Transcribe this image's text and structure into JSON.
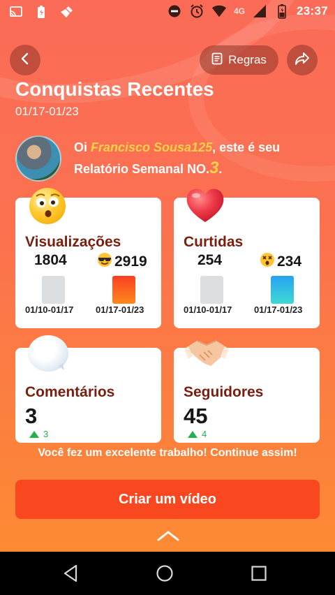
{
  "status_bar": {
    "time": "23:37",
    "network": "4G",
    "left_icons": [
      "cast-icon",
      "battery-saver-icon",
      "broom-icon"
    ],
    "right_icons": [
      "do-not-disturb-icon",
      "alarm-icon",
      "wifi-icon",
      "signal-icon",
      "battery-icon"
    ]
  },
  "header": {
    "back_icon": "chevron-left-icon",
    "rules_label": "Regras",
    "rules_icon": "document-icon",
    "share_icon": "share-icon"
  },
  "page": {
    "title": "Conquistas Recentes",
    "date_range": "01/17-01/23"
  },
  "greeting": {
    "prefix": "Oi ",
    "username": "Francisco Sousa125",
    "middle": ", este é seu Relatório Semanal NO.",
    "report_number": "3",
    "suffix": "."
  },
  "cards": {
    "views": {
      "title": "Visualizações",
      "icon": "dizzy-face-emoji",
      "prev_value": "1804",
      "curr_value": "2919",
      "curr_emoji": "cool-face-emoji",
      "prev_label": "01/10-01/17",
      "curr_label": "01/17-01/23",
      "prev_color": "#dcdfe1",
      "curr_color": "#fb5a1e"
    },
    "likes": {
      "title": "Curtidas",
      "icon": "heart-emoji",
      "prev_value": "254",
      "curr_value": "234",
      "curr_emoji": "dizzy-face-emoji",
      "prev_label": "01/10-01/17",
      "curr_label": "01/17-01/23",
      "prev_color": "#dcdfe1",
      "curr_color": "#2bb3f0"
    },
    "comments": {
      "title": "Comentários",
      "icon": "speech-bubble-emoji",
      "value": "3",
      "delta": "3"
    },
    "followers": {
      "title": "Seguidores",
      "icon": "handshake-emoji",
      "value": "45",
      "delta": "4"
    }
  },
  "footer": {
    "message": "Você fez um excelente trabalho! Continue assim!",
    "cta_label": "Criar um vídeo",
    "expand_icon": "chevron-up-icon"
  },
  "nav_bar": {
    "back": "nav-back-icon",
    "home": "nav-home-icon",
    "recents": "nav-recents-icon"
  },
  "colors": {
    "accent": "#f9481f",
    "title_brown": "#7a1f0f",
    "highlight_yellow": "#ffd24a",
    "growth_green": "#22b14c"
  }
}
